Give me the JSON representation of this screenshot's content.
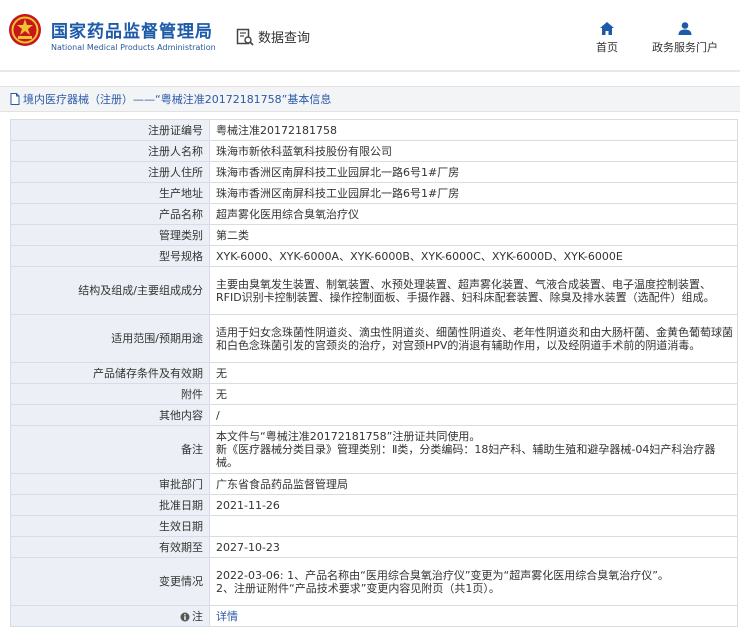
{
  "header": {
    "title_cn": "国家药品监督管理局",
    "title_en": "National Medical Products Administration",
    "query_label": "数据查询",
    "nav": [
      {
        "label": "首页",
        "icon": "home-icon"
      },
      {
        "label": "政务服务门户",
        "icon": "user-icon"
      }
    ]
  },
  "breadcrumb": {
    "text": "境内医疗器械（注册）——“粤械注准20172181758”基本信息"
  },
  "rows": [
    {
      "label": "注册证编号",
      "value": "粤械注准20172181758"
    },
    {
      "label": "注册人名称",
      "value": "珠海市新依科蓝氧科技股份有限公司"
    },
    {
      "label": "注册人住所",
      "value": "珠海市香洲区南屏科技工业园屏北一路6号1#厂房"
    },
    {
      "label": "生产地址",
      "value": "珠海市香洲区南屏科技工业园屏北一路6号1#厂房"
    },
    {
      "label": "产品名称",
      "value": "超声雾化医用综合臭氧治疗仪"
    },
    {
      "label": "管理类别",
      "value": "第二类"
    },
    {
      "label": "型号规格",
      "value": "XYK-6000、XYK-6000A、XYK-6000B、XYK-6000C、XYK-6000D、XYK-6000E"
    },
    {
      "label": "结构及组成/主要组成成分",
      "value": "主要由臭氧发生装置、制氧装置、水预处理装置、超声雾化装置、气液合成装置、电子温度控制装置、RFID识别卡控制装置、操作控制面板、手摄作器、妇科床配套装置、除臭及排水装置（选配件）组成。"
    },
    {
      "label": "适用范围/预期用途",
      "value": "适用于妇女念珠菌性阴道炎、滴虫性阴道炎、细菌性阴道炎、老年性阴道炎和由大肠杆菌、金黄色葡萄球菌和白色念珠菌引发的宫颈炎的治疗，对宫颈HPV的消退有辅助作用，以及经阴道手术前的阴道消毒。"
    },
    {
      "label": "产品储存条件及有效期",
      "value": "无"
    },
    {
      "label": "附件",
      "value": "无"
    },
    {
      "label": "其他内容",
      "value": "/"
    },
    {
      "label": "备注",
      "value": "本文件与“粤械注准20172181758”注册证共同使用。\n新《医疗器械分类目录》管理类别：Ⅱ类，分类编码：18妇产科、辅助生殖和避孕器械-04妇产科治疗器械。"
    },
    {
      "label": "审批部门",
      "value": "广东省食品药品监督管理局"
    },
    {
      "label": "批准日期",
      "value": "2021-11-26"
    },
    {
      "label": "生效日期",
      "value": ""
    },
    {
      "label": "有效期至",
      "value": "2027-10-23"
    },
    {
      "label": "变更情况",
      "value": "2022-03-06: 1、产品名称由“医用综合臭氧治疗仪”变更为“超声雾化医用综合臭氧治疗仪”。\n2、注册证附件“产品技术要求”变更内容见附页（共1页）。"
    },
    {
      "label": "注",
      "value": "详情",
      "icon": "note-icon",
      "value_is_link": true
    }
  ]
}
